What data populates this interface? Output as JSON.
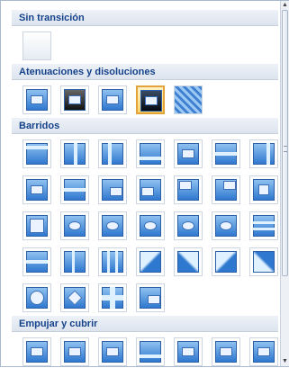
{
  "sections": [
    {
      "title": "Sin transición",
      "rows": [
        [
          "none"
        ]
      ]
    },
    {
      "title": "Atenuaciones y disoluciones",
      "rows": [
        [
          "fade",
          "fade-black",
          "cut",
          "cut-black",
          "dissolve"
        ]
      ],
      "selected": "cut-black"
    },
    {
      "title": "Barridos",
      "rows": [
        [
          "wipe-down",
          "wipe-left",
          "wipe-right",
          "wipe-up",
          "split-vertical-out",
          "split-vertical-in",
          "wipe-left-2"
        ],
        [
          "strips-right",
          "strips-up",
          "strips-right-up",
          "strips-left-up",
          "strips-left-down",
          "strips-right-down",
          "box-in"
        ],
        [
          "box-out",
          "wheel-1",
          "wheel-2",
          "wheel-3",
          "wheel-4",
          "wheel-8",
          "split-horizontal-in"
        ],
        [
          "split-horizontal-out",
          "split-vertical-in-2",
          "split-vertical-out-2",
          "strips-down-right",
          "strips-down-left",
          "strips-up-right",
          "strips-up-left"
        ],
        [
          "circle",
          "diamond",
          "plus",
          "shape"
        ]
      ]
    },
    {
      "title": "Empujar y cubrir",
      "rows": [
        [
          "push-down",
          "push-left",
          "push-right",
          "push-up",
          "cover-down",
          "cover-left",
          "cover-right"
        ]
      ]
    }
  ]
}
